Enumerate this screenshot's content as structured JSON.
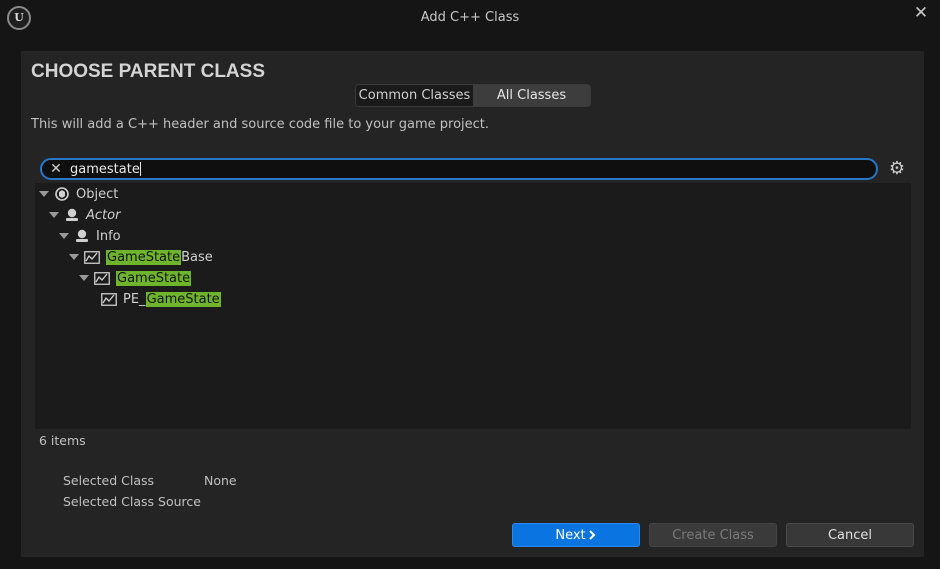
{
  "window": {
    "title": "Add C++ Class",
    "logo_text": "U"
  },
  "heading": "CHOOSE PARENT CLASS",
  "tabs": [
    {
      "label": "Common Classes",
      "selected": false
    },
    {
      "label": "All Classes",
      "selected": true
    }
  ],
  "description": "This will add a C++ header and source code file to your game project.",
  "search": {
    "value": "gamestate",
    "placeholder": ""
  },
  "tree": [
    {
      "pre": "Object",
      "match": "",
      "post": "",
      "icon": "object-icon",
      "expanded": true,
      "italic": false
    },
    {
      "pre": "Actor",
      "match": "",
      "post": "",
      "icon": "actor-icon",
      "expanded": true,
      "italic": true
    },
    {
      "pre": "Info",
      "match": "",
      "post": "",
      "icon": "actor-icon",
      "expanded": true,
      "italic": false
    },
    {
      "pre": "",
      "match": "GameState",
      "post": "Base",
      "icon": "class-graph-icon",
      "expanded": true,
      "italic": false
    },
    {
      "pre": "",
      "match": "GameState",
      "post": "",
      "icon": "class-graph-icon",
      "expanded": true,
      "italic": false
    },
    {
      "pre": "PE_",
      "match": "GameState",
      "post": "",
      "icon": "class-graph-icon",
      "expanded": false,
      "italic": false
    }
  ],
  "item_count": "6 items",
  "selected_class": {
    "label": "Selected Class",
    "value": "None"
  },
  "selected_source": {
    "label": "Selected Class Source",
    "value": ""
  },
  "buttons": {
    "next": "Next",
    "create": "Create Class",
    "cancel": "Cancel"
  },
  "colors": {
    "accent": "#0a74e0",
    "highlight": "#6fb52c",
    "search_border": "#2677c7"
  }
}
